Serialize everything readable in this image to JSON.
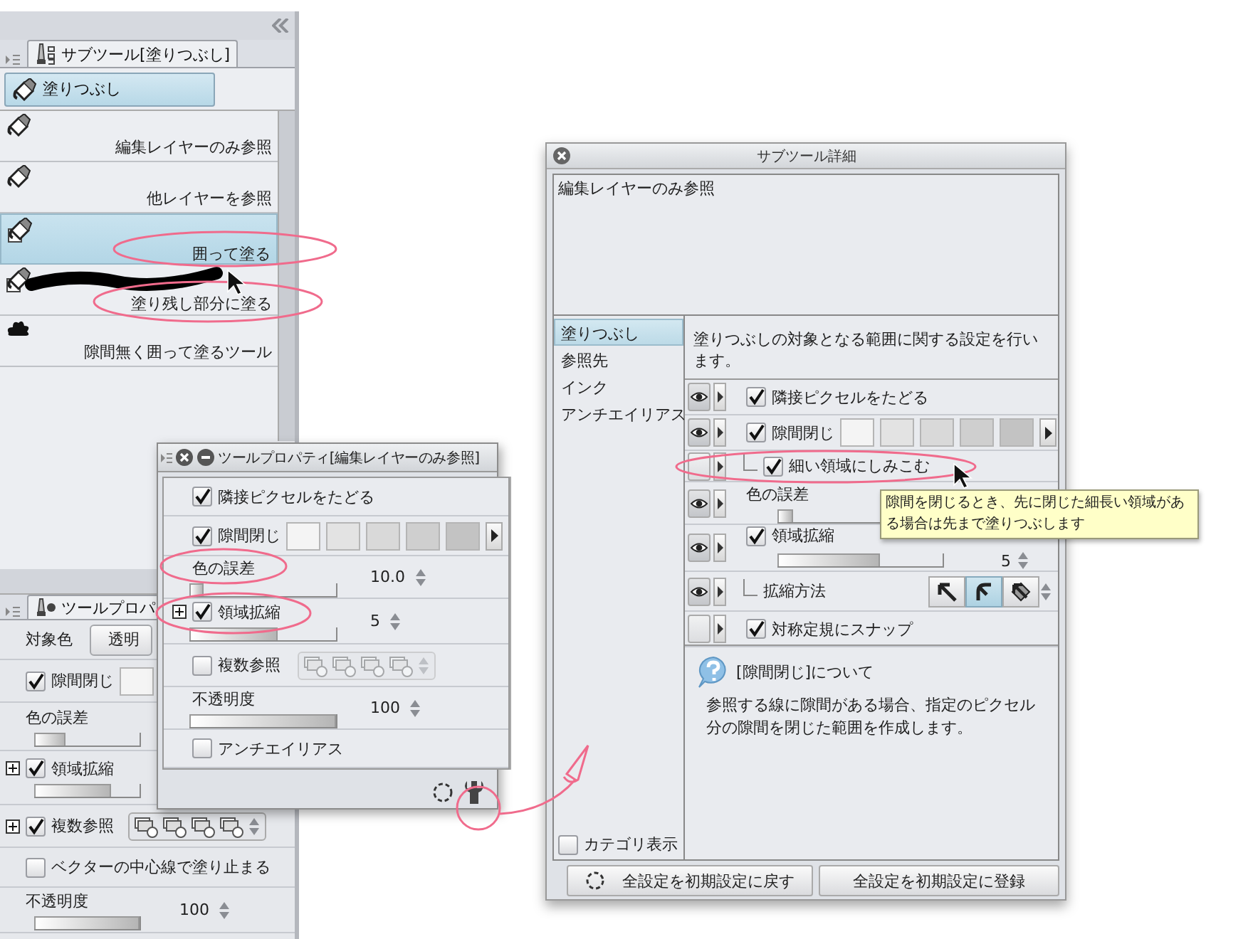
{
  "left_dock": {
    "subtool_palette": {
      "tab": "サブツール[塗りつぶし]",
      "group": "塗りつぶし",
      "items": [
        {
          "label": "編集レイヤーのみ参照",
          "kind": "bucket",
          "selected": false,
          "stroke_preview": false
        },
        {
          "label": "他レイヤーを参照",
          "kind": "bucket",
          "selected": false,
          "stroke_preview": false
        },
        {
          "label": "囲って塗る",
          "kind": "bucket_frame",
          "selected": true,
          "stroke_preview": false
        },
        {
          "label": "塗り残し部分に塗る",
          "kind": "bucket_frame",
          "selected": false,
          "stroke_preview": true
        },
        {
          "label": "隙間無く囲って塗るツール",
          "kind": "blot",
          "selected": false,
          "stroke_preview": false
        }
      ]
    },
    "tool_property_palette": {
      "tab": "ツールプロパ",
      "rows": [
        {
          "kind": "button",
          "label": "対象色",
          "value": "透明"
        },
        {
          "kind": "swatches",
          "label": "隙間閉じ",
          "checked": true,
          "expandable": false
        },
        {
          "kind": "slider",
          "label": "色の誤差",
          "level": 0.3
        },
        {
          "kind": "check_slider",
          "label": "領域拡縮",
          "checked": true,
          "expandable": true,
          "level": 0.73
        },
        {
          "kind": "check_icons",
          "label": "複数参照",
          "checked": true,
          "expandable": true
        },
        {
          "kind": "check",
          "label": "ベクターの中心線で塗り止まる",
          "checked": false,
          "expandable": false
        },
        {
          "kind": "slider",
          "label": "不透明度",
          "level": 1,
          "value": "100"
        }
      ]
    }
  },
  "tool_property_popup": {
    "title": "ツールプロパティ[編集レイヤーのみ参照]",
    "rows": [
      {
        "kind": "check",
        "label": "隣接ピクセルをたどる",
        "checked": true,
        "expandable": false
      },
      {
        "kind": "swatches",
        "label": "隙間閉じ",
        "checked": true,
        "expandable": false
      },
      {
        "kind": "slider",
        "label": "色の誤差",
        "level": 0.1,
        "value": "10.0"
      },
      {
        "kind": "check_slider",
        "label": "領域拡縮",
        "checked": true,
        "expandable": true,
        "level": 0.6,
        "value": "5"
      },
      {
        "kind": "check_icons",
        "label": "複数参照",
        "checked": false,
        "expandable": false
      },
      {
        "kind": "slider",
        "label": "不透明度",
        "level": 1,
        "value": "100"
      },
      {
        "kind": "check",
        "label": "アンチエイリアス",
        "checked": false,
        "expandable": false
      }
    ]
  },
  "subtool_detail": {
    "title": "サブツール詳細",
    "preset_name": "編集レイヤーのみ参照",
    "categories": [
      {
        "label": "塗りつぶし",
        "selected": true
      },
      {
        "label": "参照先",
        "selected": false
      },
      {
        "label": "インク",
        "selected": false
      },
      {
        "label": "アンチエイリアス",
        "selected": false
      }
    ],
    "category_toggle": {
      "label": "カテゴリ表示",
      "checked": false
    },
    "description": "塗りつぶしの対象となる範囲に関する設定を行います。",
    "settings": [
      {
        "kind": "check",
        "label": "隣接ピクセルをたどる",
        "checked": true,
        "visible": true
      },
      {
        "kind": "swatches",
        "label": "隙間閉じ",
        "checked": true,
        "visible": true,
        "children": [
          {
            "kind": "check",
            "label": "細い領域にしみこむ",
            "checked": true,
            "visible": false
          }
        ]
      },
      {
        "kind": "slider",
        "label": "色の誤差",
        "level": 0.1,
        "visible": true
      },
      {
        "kind": "check_slider",
        "label": "領域拡縮",
        "checked": true,
        "visible": true,
        "level": 0.62,
        "value": "5",
        "children": [
          {
            "kind": "method",
            "label": "拡縮方法",
            "visible": true,
            "options": [
              {
                "kind": "square",
                "selected": false
              },
              {
                "kind": "round",
                "selected": true
              },
              {
                "kind": "pattern",
                "selected": false
              }
            ]
          }
        ]
      },
      {
        "kind": "check",
        "label": "対称定規にスナップ",
        "checked": true,
        "visible": false
      }
    ],
    "help": {
      "title": "[隙間閉じ]について",
      "body": "参照する線に隙間がある場合、指定のピクセル分の隙間を閉じた範囲を作成します。"
    },
    "buttons": [
      {
        "kind": "reset",
        "label": "全設定を初期設定に戻す"
      },
      {
        "kind": "register",
        "label": "全設定を初期設定に登録"
      }
    ]
  },
  "tooltip": "隙間を閉じるとき、先に閉じた細長い領域がある場合は先まで塗りつぶします"
}
